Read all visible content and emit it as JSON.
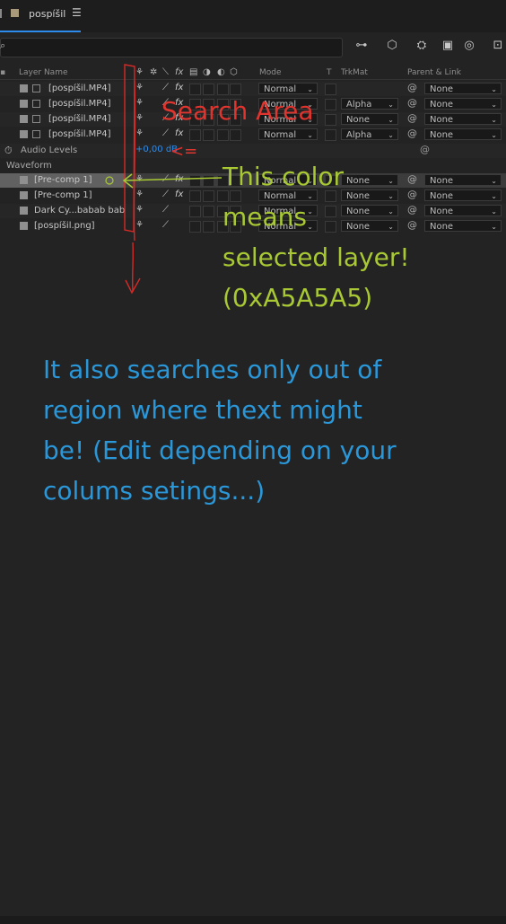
{
  "tab": {
    "title": "pospíšil",
    "menu_icon": "hamburger-icon"
  },
  "toolbar": {
    "search_placeholder": "",
    "tools": [
      "comp-flowchart-icon",
      "draft-3d-icon",
      "shy-icon",
      "frame-blend-icon",
      "motion-blur-icon",
      "graph-editor-icon"
    ]
  },
  "columns": {
    "layer_name": "Layer Name",
    "mode": "Mode",
    "t": "T",
    "trkmat": "TrkMat",
    "parent": "Parent & Link"
  },
  "rows_top": [
    {
      "name": "[pospíšil.MP4]",
      "mode": "Normal",
      "trkmat": "",
      "parent": "None"
    },
    {
      "name": "[pospíšil.MP4]",
      "mode": "Normal",
      "trkmat": "Alpha",
      "parent": "None"
    },
    {
      "name": "[pospíšil.MP4]",
      "mode": "Normal",
      "trkmat": "None",
      "parent": "None"
    },
    {
      "name": "[pospíšil.MP4]",
      "mode": "Normal",
      "trkmat": "Alpha",
      "parent": "None"
    }
  ],
  "audio": {
    "label": "Audio Levels",
    "value": "+0,00 dB",
    "waveform": "Waveform"
  },
  "rows_bottom": [
    {
      "name": "[Pre-comp 1]",
      "mode": "Normal",
      "trkmat": "None",
      "parent": "None",
      "selected": true
    },
    {
      "name": "[Pre-comp 1]",
      "mode": "Normal",
      "trkmat": "None",
      "parent": "None"
    },
    {
      "name": "Dark Cy...babab bab",
      "mode": "Normal",
      "trkmat": "None",
      "parent": "None"
    },
    {
      "name": "[pospíšil.png]",
      "mode": "Normal",
      "trkmat": "None",
      "parent": "None"
    }
  ],
  "annotations": {
    "search_area": "Search Area",
    "arrow_left": "<=",
    "color_note_1": "This color",
    "color_note_2": "means",
    "color_note_3": "selected layer!",
    "color_note_4": "(0xA5A5A5)",
    "blue_1": "It also searches only out of",
    "blue_2": "region where thext might",
    "blue_3": "be! (Edit depending on your",
    "blue_4": "colums setings...)"
  },
  "colors": {
    "selected": "#A5A5A5",
    "accent": "#2d8ceb",
    "red": "#e0342f",
    "green": "#a8c934",
    "blue": "#2a97d9"
  }
}
